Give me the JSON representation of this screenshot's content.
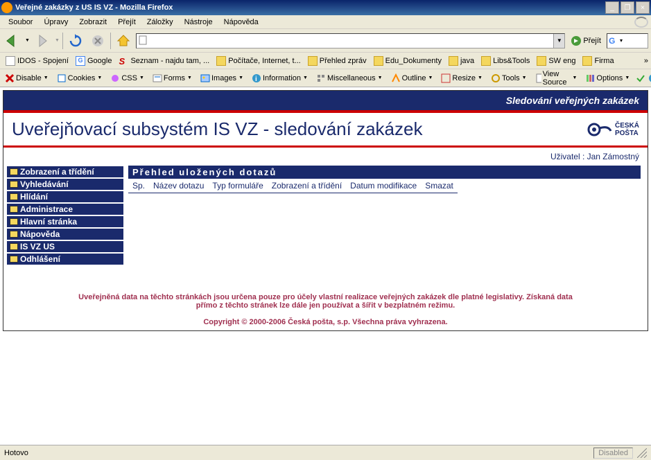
{
  "window": {
    "title": "Veřejné zakázky z US IS VZ - Mozilla Firefox",
    "min": "_",
    "max": "□",
    "restore": "❐",
    "close": "×"
  },
  "menu": [
    "Soubor",
    "Úpravy",
    "Zobrazit",
    "Přejít",
    "Záložky",
    "Nástroje",
    "Nápověda"
  ],
  "nav": {
    "go_label": "Přejít"
  },
  "bookmarks": [
    {
      "label": "IDOS - Spojení",
      "type": "page"
    },
    {
      "label": "Google",
      "type": "g"
    },
    {
      "label": "Seznam - najdu tam, ...",
      "type": "s"
    },
    {
      "label": "Počítače, Internet, t...",
      "type": "folder"
    },
    {
      "label": "Přehled zpráv",
      "type": "folder"
    },
    {
      "label": "Edu_Dokumenty",
      "type": "folder"
    },
    {
      "label": "java",
      "type": "folder"
    },
    {
      "label": "Libs&Tools",
      "type": "folder"
    },
    {
      "label": "SW eng",
      "type": "folder"
    },
    {
      "label": "Firma",
      "type": "folder"
    }
  ],
  "devtoolbar": [
    {
      "label": "Disable",
      "icon": "x"
    },
    {
      "label": "Cookies",
      "icon": "cookie"
    },
    {
      "label": "CSS",
      "icon": "css"
    },
    {
      "label": "Forms",
      "icon": "form"
    },
    {
      "label": "Images",
      "icon": "img"
    },
    {
      "label": "Information",
      "icon": "info"
    },
    {
      "label": "Miscellaneous",
      "icon": "misc"
    },
    {
      "label": "Outline",
      "icon": "outline"
    },
    {
      "label": "Resize",
      "icon": "resize"
    },
    {
      "label": "Tools",
      "icon": "tools"
    },
    {
      "label": "View Source",
      "icon": "source"
    },
    {
      "label": "Options",
      "icon": "options"
    }
  ],
  "page": {
    "topbar": "Sledování veřejných zakázek",
    "title": "Uveřejňovací subsystém IS VZ - sledování zakázek",
    "logo_text_top": "ČESKÁ",
    "logo_text_bot": "POŠTA",
    "user_prefix": "Uživatel : ",
    "user_name": "Jan Zámostný",
    "nav": [
      "Zobrazení a třídění",
      "Vyhledávání",
      "Hlídání",
      "Administrace",
      "Hlavní stránka",
      "Nápověda",
      "IS VZ US",
      "Odhlášení"
    ],
    "section": "Přehled uložených dotazů",
    "columns": [
      "Sp.",
      "Název dotazu",
      "Typ formuláře",
      "Zobrazení a třídění",
      "Datum modifikace",
      "Smazat"
    ],
    "disclaimer": "Uveřejněná data na těchto stránkách jsou určena pouze pro účely vlastní realizace veřejných zakázek dle platné legislativy. Získaná data přímo z těchto stránek lze dále jen používat a šířit v bezplatném režimu.",
    "copyright": "Copyright © 2000-2006 Česká pošta, s.p. Všechna práva vyhrazena."
  },
  "status": {
    "left": "Hotovo",
    "disabled": "Disabled"
  }
}
